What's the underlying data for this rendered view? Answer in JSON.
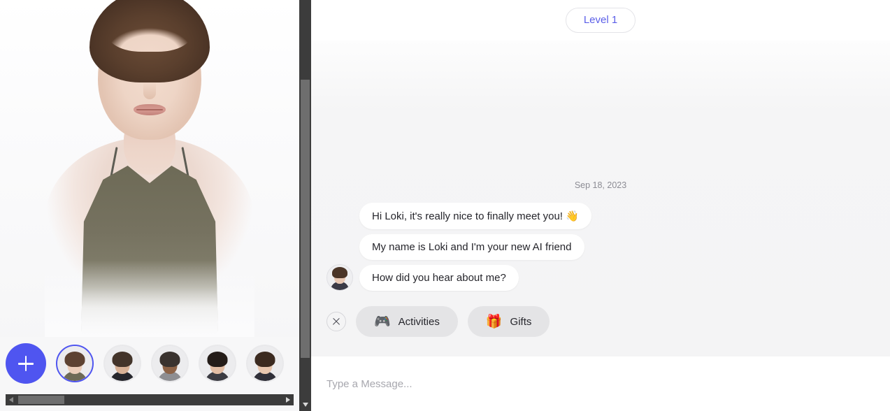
{
  "avatar_panel": {
    "add_button_label": "+",
    "add_button_icon": "plus-icon",
    "selected_thumb_index": 0,
    "thumbnails": [
      {
        "name": "avatar-thumb-1",
        "hair": "#5d4232",
        "skin": "#ebcdb9",
        "outfit": "#6e6a56",
        "selected": true
      },
      {
        "name": "avatar-thumb-2",
        "hair": "#43342a",
        "skin": "#d8b196",
        "outfit": "#26262c",
        "selected": false
      },
      {
        "name": "avatar-thumb-3",
        "hair": "#3a332f",
        "skin": "#8d6347",
        "outfit": "#8e8e92",
        "selected": false
      },
      {
        "name": "avatar-thumb-4",
        "hair": "#241c18",
        "skin": "#e2bda4",
        "outfit": "#3b3b42",
        "selected": false
      },
      {
        "name": "avatar-thumb-5",
        "hair": "#3b2a20",
        "skin": "#e7c6af",
        "outfit": "#2f2f38",
        "selected": false
      }
    ],
    "scrollbar": {
      "left_arrow_icon": "caret-left-icon",
      "right_arrow_icon": "caret-right-icon"
    }
  },
  "vertical_scrollbar": {
    "down_arrow_icon": "caret-down-icon"
  },
  "chat": {
    "level_badge": "Level 1",
    "date_divider": "Sep 18, 2023",
    "messages": [
      {
        "text": "Hi Loki, it's really nice to finally meet you! 👋",
        "has_avatar": false
      },
      {
        "text": "My name is Loki and I'm your new AI friend",
        "has_avatar": false
      },
      {
        "text": "How did you hear about me?",
        "has_avatar": true
      }
    ],
    "quick_actions": {
      "close_icon": "close-icon",
      "chips": [
        {
          "label": "Activities",
          "emoji": "🎮",
          "icon_name": "gamepad-icon"
        },
        {
          "label": "Gifts",
          "emoji": "🎁",
          "icon_name": "gift-icon"
        }
      ]
    },
    "composer": {
      "placeholder": "Type a Message...",
      "value": ""
    }
  },
  "colors": {
    "accent": "#4f55f0",
    "level_text": "#5b5fe8",
    "chip_bg": "#e4e4e6",
    "chat_bg": "#f4f4f5"
  }
}
